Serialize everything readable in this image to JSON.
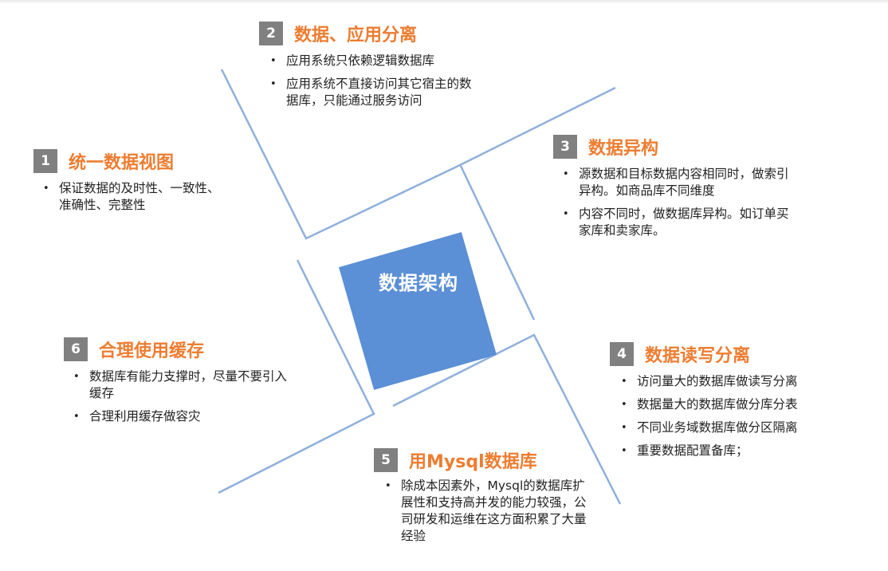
{
  "center": {
    "label": "数据架构"
  },
  "sections": [
    {
      "num": "1",
      "title": "统一数据视图",
      "items": [
        "保证数据的及时性、一致性、准确性、完整性"
      ]
    },
    {
      "num": "2",
      "title": "数据、应用分离",
      "items": [
        "应用系统只依赖逻辑数据库",
        "应用系统不直接访问其它宿主的数据库，只能通过服务访问"
      ]
    },
    {
      "num": "3",
      "title": "数据异构",
      "items": [
        "源数据和目标数据内容相同时，做索引异构。如商品库不同维度",
        "内容不同时，做数据库异构。如订单买家库和卖家库。"
      ]
    },
    {
      "num": "4",
      "title": "数据读写分离",
      "items": [
        "访问量大的数据库做读写分离",
        "数据量大的数据库做分库分表",
        "不同业务域数据库做分区隔离",
        "重要数据配置备库；"
      ]
    },
    {
      "num": "5",
      "title": "用Mysql数据库",
      "items": [
        "除成本因素外，Mysql的数据库扩展性和支持高并发的能力较强，公司研发和运维在这方面积累了大量经验"
      ]
    },
    {
      "num": "6",
      "title": "合理使用缓存",
      "items": [
        "数据库有能力支撑时，尽量不要引入缓存",
        "合理利用缓存做容灾"
      ]
    }
  ],
  "colors": {
    "accent": "#ed7d31",
    "center": "#5b8fd6",
    "lines": "#8eb0dc",
    "badge": "#808080"
  }
}
